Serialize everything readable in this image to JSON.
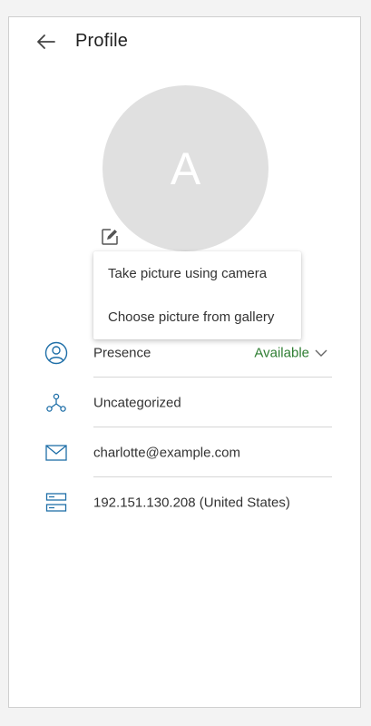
{
  "header": {
    "title": "Profile",
    "back_icon": "arrow-left-icon"
  },
  "avatar": {
    "initial": "A",
    "edit_icon": "edit-pencil-icon"
  },
  "picture_menu": {
    "items": [
      {
        "label": "Take picture using camera"
      },
      {
        "label": "Choose picture from gallery"
      }
    ]
  },
  "details": {
    "presence": {
      "label": "Presence",
      "value": "Available",
      "icon": "user-circle-icon",
      "value_color": "#2e7d32"
    },
    "category": {
      "label": "Uncategorized",
      "icon": "network-nodes-icon"
    },
    "email": {
      "label": "charlotte@example.com",
      "icon": "envelope-icon"
    },
    "ip": {
      "label": "192.151.130.208 (United States)",
      "icon": "server-icon"
    }
  },
  "colors": {
    "accent_icon": "#1f6fa8",
    "available": "#2e7d32",
    "avatar_bg": "#e0e0e0"
  }
}
